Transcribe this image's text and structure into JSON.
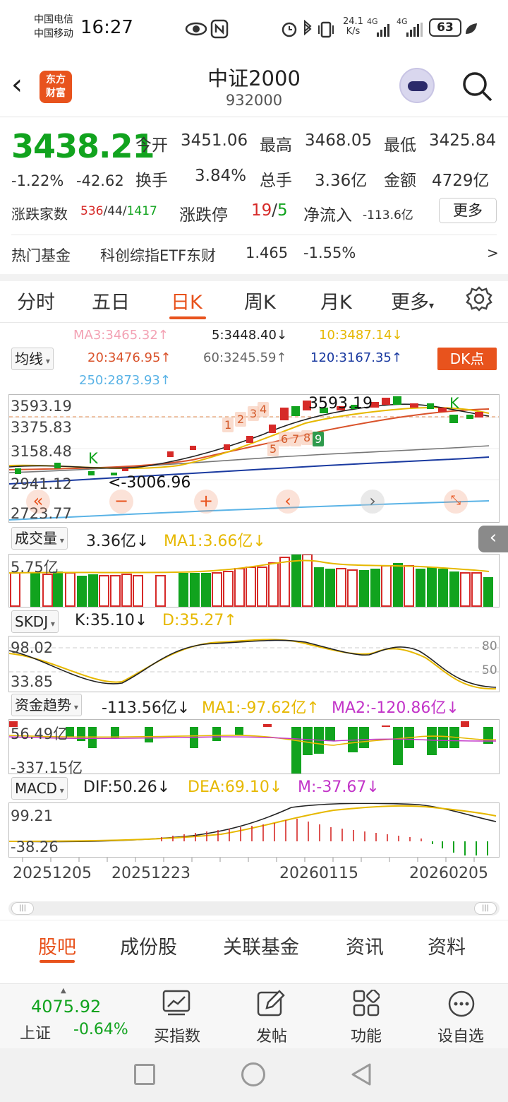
{
  "status": {
    "carrier1": "中国电信",
    "carrier2": "中国移动",
    "time": "16:27",
    "net_speed_val": "24.1",
    "net_speed_unit": "K/s",
    "sig1": "4G",
    "sig2": "4G",
    "battery": "63"
  },
  "header": {
    "title": "中证2000",
    "code": "932000",
    "logo_line1": "东方",
    "logo_line2": "财富"
  },
  "quote": {
    "price": "3438.21",
    "pct": "-1.22%",
    "chg": "-42.62",
    "open_label": "今开",
    "open": "3451.06",
    "high_label": "最高",
    "high": "3468.05",
    "low_label": "最低",
    "low": "3425.84",
    "turnover_label": "换手",
    "turnover": "3.84%",
    "vol_label": "总手",
    "vol": "3.36亿",
    "amount_label": "金额",
    "amount": "4729亿",
    "breadth_label": "涨跌家数",
    "up": "536",
    "flat": "44",
    "down": "1417",
    "limit_label": "涨跌停",
    "limit_up": "19",
    "limit_down": "5",
    "inflow_label": "净流入",
    "inflow": "-113.6亿",
    "more": "更多"
  },
  "fund": {
    "label": "热门基金",
    "name": "科创综指ETF东财",
    "price": "1.465",
    "pct": "-1.55%",
    "arrow": ">"
  },
  "tabs": {
    "t1": "分时",
    "t2": "五日",
    "t3": "日K",
    "t4": "周K",
    "t5": "月K",
    "t6": "更多"
  },
  "ma_row": {
    "ma3": "MA3:3465.32↑",
    "ma5": "5:3448.40↓",
    "ma10": "10:3487.14↓",
    "ma20": "20:3476.95↑",
    "ma60": "60:3245.59↑",
    "ma120": "120:3167.35↑",
    "ma250": "250:2873.93↑",
    "selector": "均线",
    "dk": "DK点"
  },
  "kchart": {
    "y_ticks": [
      "3593.19",
      "3375.83",
      "3158.48",
      "2941.12",
      "2723.77"
    ],
    "high_mark": "3593.19",
    "low_mark": "<-3006.96",
    "k1": "K",
    "k2": "K",
    "nums": [
      "1",
      "2",
      "3",
      "4",
      "5",
      "6",
      "7",
      "8",
      "9"
    ]
  },
  "vol": {
    "selector": "成交量",
    "value": "3.36亿↓",
    "ma1": "MA1:3.66亿↓",
    "axis": "5.75亿"
  },
  "skdj": {
    "selector": "SKDJ",
    "k": "K:35.10↓",
    "d": "D:35.27↑",
    "y1": "98.02",
    "y2": "33.85",
    "r80": "80",
    "r50": "50"
  },
  "fundtrend": {
    "selector": "资金趋势",
    "value": "-113.56亿↓",
    "ma1": "MA1:-97.62亿↑",
    "ma2": "MA2:-120.86亿↓",
    "y1": "56.49亿",
    "y2": "-337.15亿"
  },
  "macd": {
    "selector": "MACD",
    "dif": "DIF:50.26↓",
    "dea": "DEA:69.10↓",
    "m": "M:-37.67↓",
    "y1": "99.21",
    "y2": "-38.26"
  },
  "dates": [
    "20251205",
    "20251223",
    "20260115",
    "20260205"
  ],
  "bottom_tabs": {
    "b1": "股吧",
    "b2": "成份股",
    "b3": "关联基金",
    "b4": "资讯",
    "b5": "资料"
  },
  "bottom_bar": {
    "idx_val": "4075.92",
    "idx_name": "上证",
    "idx_pct": "-0.64%",
    "buy": "买指数",
    "post": "发帖",
    "func": "功能",
    "fav": "设自选"
  },
  "colors": {
    "up": "#d62a28",
    "down": "#11a31e",
    "accent": "#e8531d"
  }
}
